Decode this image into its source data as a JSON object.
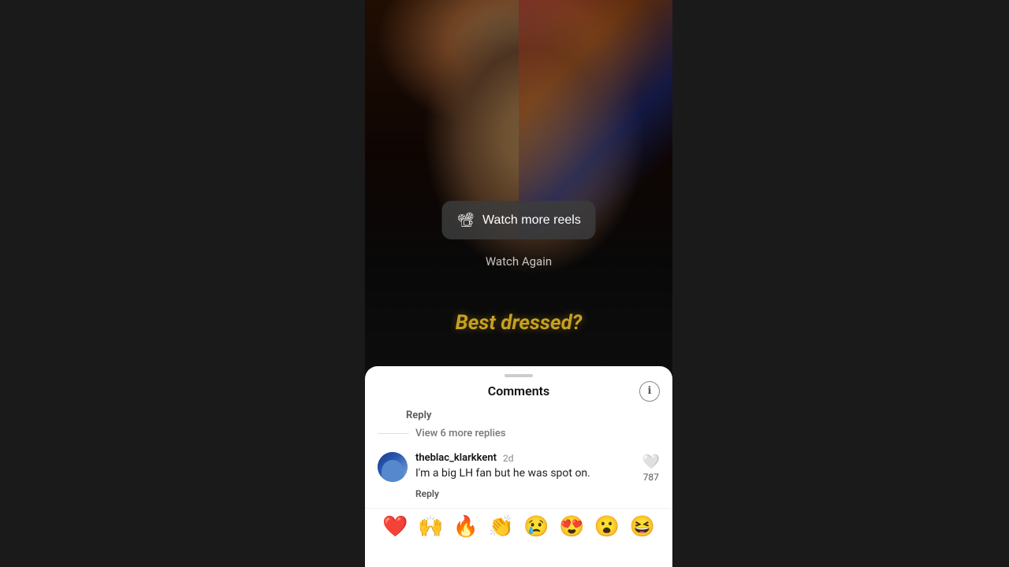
{
  "page": {
    "background_color": "#1a1a1a"
  },
  "video": {
    "overlay_text": "Best dressed?",
    "watch_reels_button": "Watch more reels",
    "watch_again_label": "Watch Again"
  },
  "comments": {
    "title": "Comments",
    "handle_label": "drag handle",
    "reply_label": "Reply",
    "view_more_replies": "View 6 more replies",
    "comment": {
      "username": "theblac_klarkkent",
      "time": "2d",
      "text": "I'm a big LH fan but he was spot on.",
      "reply_label": "Reply",
      "like_count": "787"
    }
  },
  "emojis": {
    "heart": "❤️",
    "raised_hands": "🙌",
    "fire": "🔥",
    "clapping": "👏",
    "crying": "😢",
    "heart_eyes": "😍",
    "shocked": "😮",
    "grinning": "😆"
  },
  "icons": {
    "reel": "📽",
    "info": "ℹ"
  }
}
